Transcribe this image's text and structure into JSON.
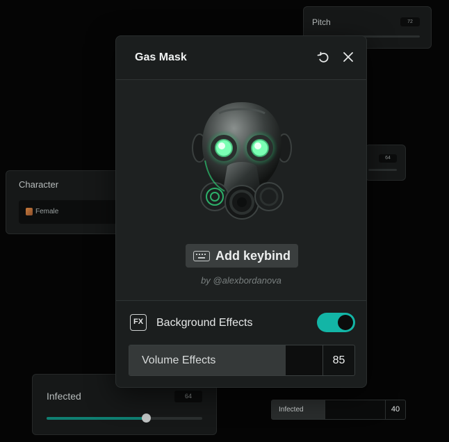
{
  "modal": {
    "title": "Gas Mask",
    "keybind_label": "Add keybind",
    "author": "by @alexbordanova",
    "fx_icon": "FX",
    "background_effects_label": "Background Effects",
    "background_effects_on": true,
    "volume_label": "Volume Effects",
    "volume_value": "85"
  },
  "pitch_panel": {
    "title": "Pitch",
    "value": "72"
  },
  "mid_panel": {
    "value": "64"
  },
  "character_panel": {
    "title": "Character",
    "selected": "Female"
  },
  "infected_panel": {
    "title": "Infected",
    "value": "64",
    "slider_fraction": 0.64
  },
  "infected_mini": {
    "label": "Infected",
    "value": "40"
  },
  "colors": {
    "accent": "#13b5a6",
    "slider_fill": "#0f7f72",
    "mask_glow": "#39f28a"
  },
  "icons": [
    "undo-icon",
    "close-icon",
    "keyboard-icon",
    "fx-icon",
    "gas-mask-image"
  ]
}
